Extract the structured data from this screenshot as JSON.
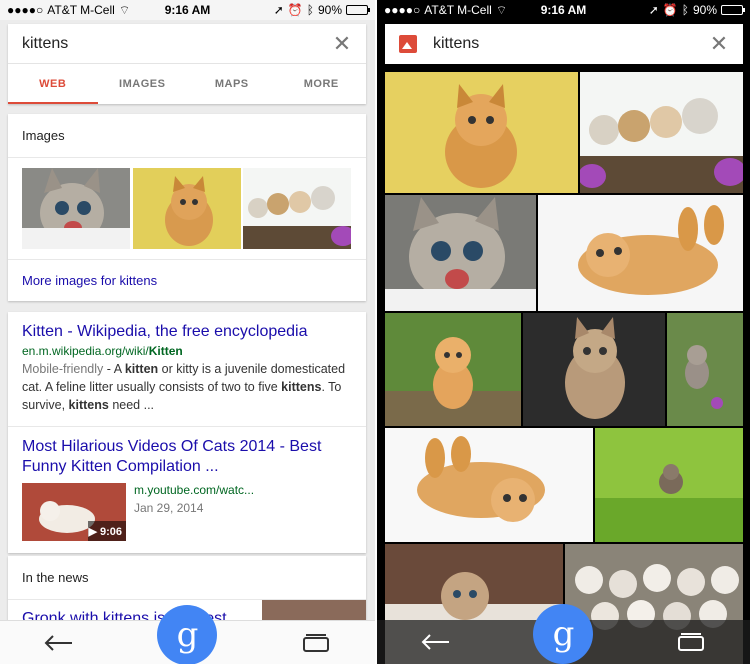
{
  "status": {
    "carrier": "AT&T M-Cell",
    "time": "9:16 AM",
    "battery": "90%",
    "battery_level": 0.9
  },
  "left": {
    "search": {
      "query": "kittens"
    },
    "tabs": [
      {
        "label": "WEB",
        "active": true
      },
      {
        "label": "IMAGES",
        "active": false
      },
      {
        "label": "MAPS",
        "active": false
      },
      {
        "label": "MORE",
        "active": false
      }
    ],
    "images_card": {
      "header": "Images",
      "more_link": "More images for kittens"
    },
    "results": [
      {
        "title": "Kitten - Wikipedia, the free encyclopedia",
        "url_prefix": "en.m.wikipedia.org/wiki/",
        "url_bold": "Kitten",
        "snippet_mobile": "Mobile-friendly",
        "snippet_1": " - A ",
        "snippet_b1": "kitten",
        "snippet_2": " or kitty is a juvenile domesticated cat. A feline litter usually consists of two to five ",
        "snippet_b2": "kittens",
        "snippet_3": ". To survive, ",
        "snippet_b3": "kittens",
        "snippet_4": " need ..."
      },
      {
        "title": "Most Hilarious Videos Of Cats 2014 - Best Funny Kitten Compilation ...",
        "url": "m.youtube.com/watc...",
        "date": "Jan 29, 2014",
        "duration": "▶ 9:06"
      }
    ],
    "news": {
      "header": "In the news",
      "title": "Gronk with kittens is the best"
    }
  },
  "right": {
    "search": {
      "query": "kittens"
    }
  },
  "icons": {
    "close": "close-icon",
    "back": "back-arrow-icon",
    "google": "g",
    "tabs": "tabs-icon",
    "image_search": "image-search-icon"
  },
  "colors": {
    "accent_red": "#dd4b39",
    "link_blue": "#1a0dab",
    "url_green": "#006621",
    "google_blue": "#4285f4"
  }
}
